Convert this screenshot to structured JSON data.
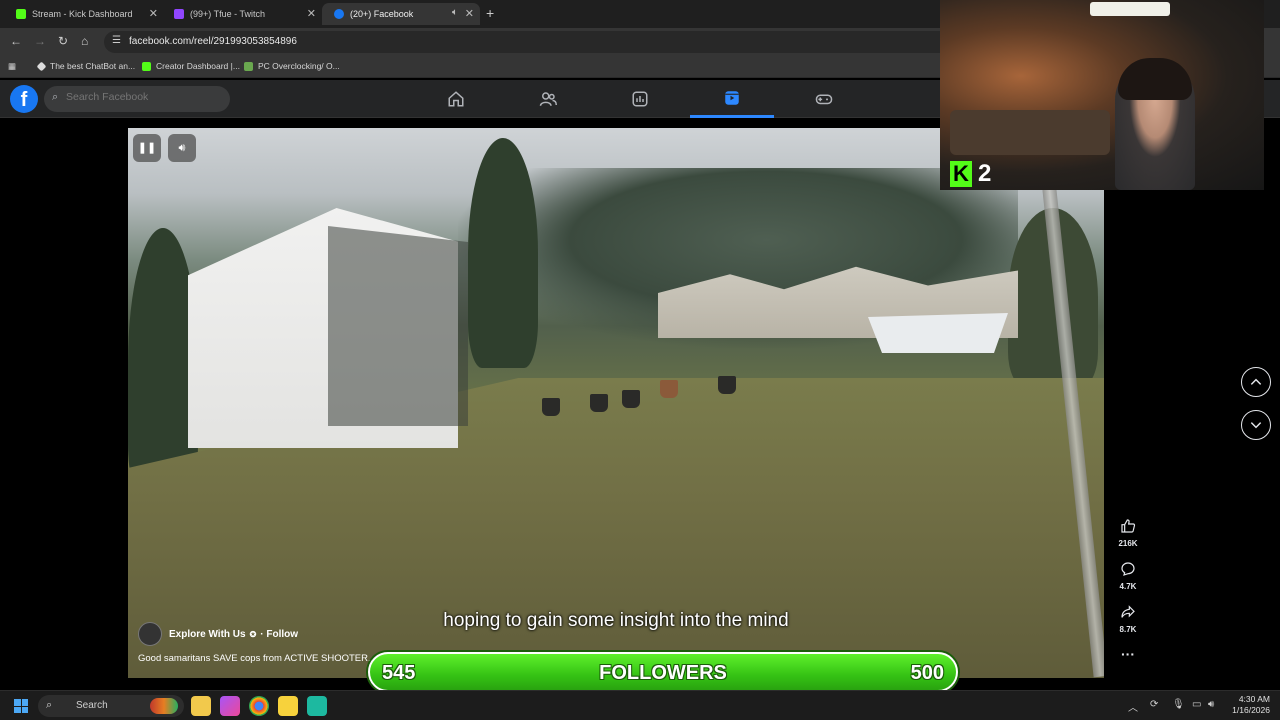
{
  "browser": {
    "tabs": [
      {
        "title": "Stream - Kick Dashboard",
        "color": "#53fc18"
      },
      {
        "title": "(99+) Tfue - Twitch",
        "color": "#9146ff"
      },
      {
        "title": "(20+) Facebook",
        "color": "#1877f2"
      }
    ],
    "url": "facebook.com/reel/291993053854896",
    "bookmarks": [
      {
        "label": "The best ChatBot an..."
      },
      {
        "label": "Creator Dashboard |..."
      },
      {
        "label": "PC Overclocking/ O..."
      }
    ]
  },
  "facebook": {
    "logo": "f",
    "search_placeholder": "Search Facebook",
    "nav_icons": [
      "home-icon",
      "friends-icon",
      "dashboard-icon",
      "reels-icon",
      "gaming-icon"
    ],
    "active_nav": "reels-icon"
  },
  "reel": {
    "caption": "hoping to gain some insight into the mind",
    "author": "Explore With Us",
    "follow_label": "· Follow",
    "description": "Good samaritans SAVE cops from ACTIVE SHOOTER...",
    "stats": {
      "likes": "216K",
      "comments": "4.7K",
      "shares": "8.7K"
    }
  },
  "overlay": {
    "kick_count": "2",
    "followers_label": "FOLLOWERS",
    "followers_current": "545",
    "followers_goal": "500"
  },
  "taskbar": {
    "search_label": "Search",
    "time": "4:30 AM",
    "date": "1/16/2026"
  }
}
